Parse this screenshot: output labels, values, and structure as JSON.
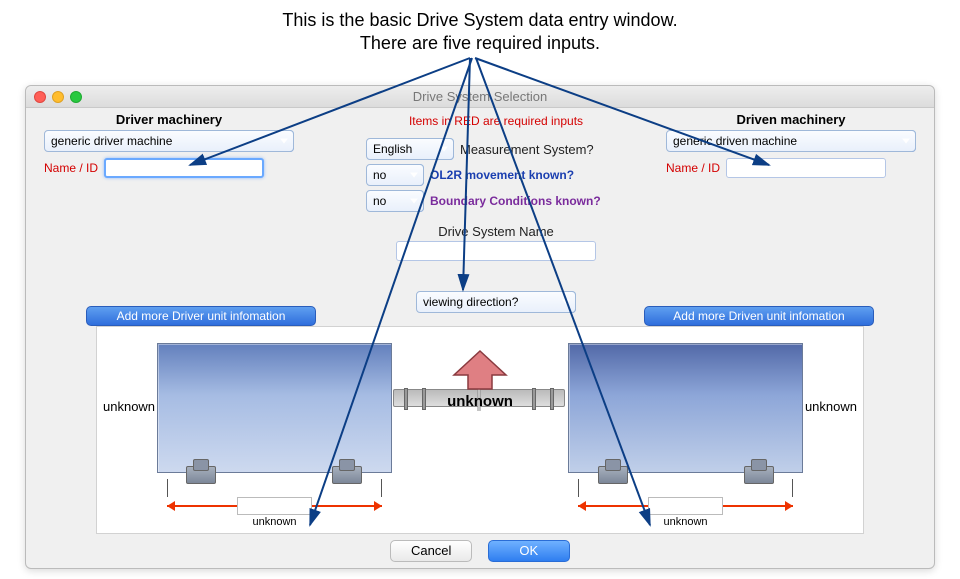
{
  "annotation": {
    "line1": "This is the basic Drive System data entry window.",
    "line2": "There are five required inputs."
  },
  "window": {
    "title": "Drive System Selection",
    "required_hint": "Items in RED are required inputs"
  },
  "driver": {
    "heading": "Driver machinery",
    "machine_select": "generic driver machine",
    "name_id_label": "Name / ID",
    "name_id_value": "",
    "add_more_button": "Add more Driver unit infomation",
    "side_label": "unknown",
    "dim_label": "unknown"
  },
  "driven": {
    "heading": "Driven machinery",
    "machine_select": "generic driven machine",
    "name_id_label": "Name / ID",
    "name_id_value": "",
    "add_more_button": "Add more Driven unit infomation",
    "side_label": "unknown",
    "dim_label": "unknown"
  },
  "center": {
    "measurement": {
      "value": "English",
      "label": "Measurement System?"
    },
    "ol2r": {
      "value": "no",
      "label": "OL2R movement known?"
    },
    "boundary": {
      "value": "no",
      "label": "Boundary Conditions known?"
    },
    "dsn_label": "Drive System Name",
    "dsn_value": "",
    "viewing": {
      "value": "viewing direction?"
    },
    "center_arrow_label": "unknown"
  },
  "buttons": {
    "cancel": "Cancel",
    "ok": "OK"
  }
}
